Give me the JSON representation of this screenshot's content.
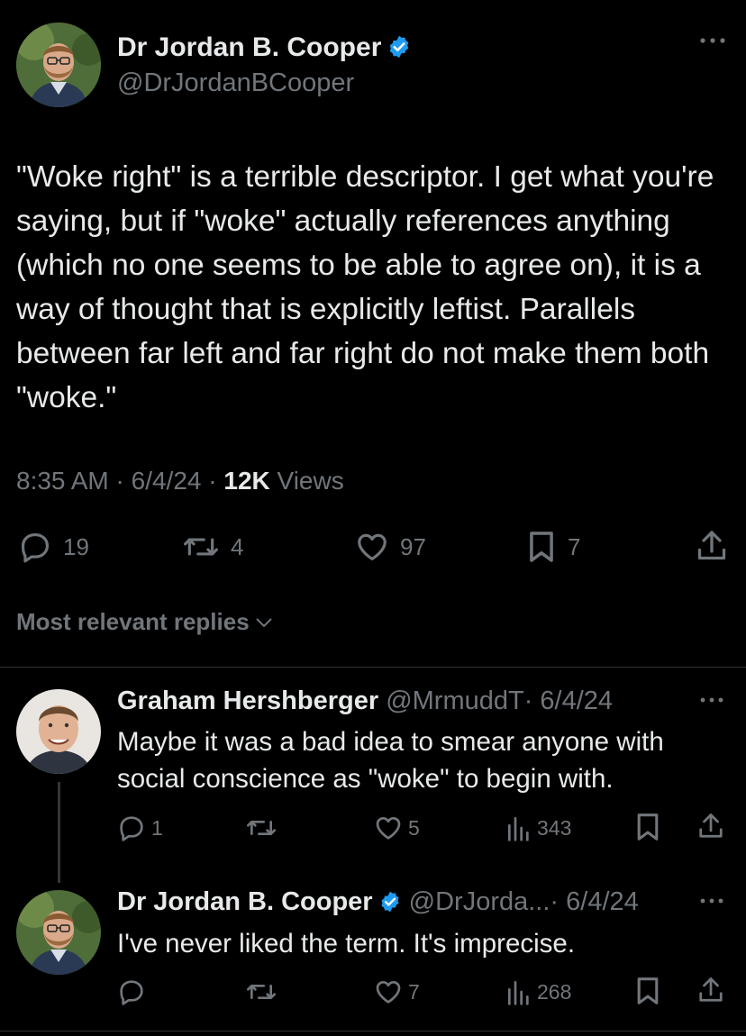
{
  "main_tweet": {
    "author_name": "Dr Jordan B. Cooper",
    "author_handle": "@DrJordanBCooper",
    "text": "\"Woke right\" is a terrible descriptor. I get what you're saying, but if \"woke\" actually references anything (which no one seems to be able to agree on), it is a way of thought that is explicitly leftist. Parallels between far left and far right do not make them both \"woke.\"",
    "time": "8:35 AM",
    "date": "6/4/24",
    "views_count": "12K",
    "views_label": "Views",
    "separator": "·",
    "replies": "19",
    "reposts": "4",
    "likes": "97",
    "bookmarks": "7"
  },
  "replies_section": {
    "label": "Most relevant replies"
  },
  "replies": [
    {
      "author_name": "Graham Hershberger",
      "author_handle": "@MrmuddT",
      "date": "· 6/4/24",
      "text": "Maybe it was a bad idea to smear anyone with social conscience as \"woke\" to begin with.",
      "replies": "1",
      "reposts": "",
      "likes": "5",
      "views": "343"
    },
    {
      "author_name": "Dr Jordan B. Cooper",
      "author_handle": "@DrJorda...",
      "date": "· 6/4/24",
      "text": "I've never liked the term. It's imprecise.",
      "replies": "",
      "reposts": "",
      "likes": "7",
      "views": "268"
    }
  ],
  "colors": {
    "background": "#000000",
    "text_primary": "#e7e9ea",
    "text_secondary": "#71767b",
    "verified_blue": "#1d9bf0",
    "divider": "#2f3336"
  }
}
